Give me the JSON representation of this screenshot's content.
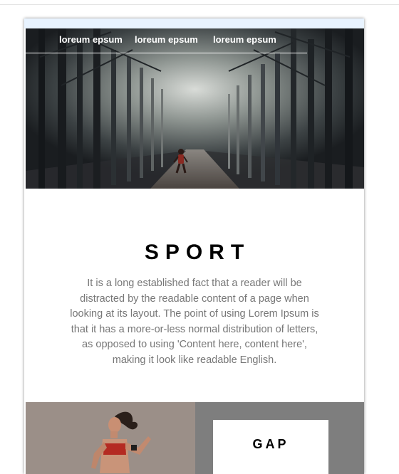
{
  "nav": {
    "items": [
      {
        "label": "loreum epsum"
      },
      {
        "label": "loreum epsum"
      },
      {
        "label": "loreum epsum"
      }
    ]
  },
  "hero": {
    "icon": "forest-runner-photo"
  },
  "section": {
    "title": "SPORT",
    "body": "It is a long established fact that a reader will be distracted by the readable content of a page when looking at its layout. The point of using Lorem Ipsum is that it has a more-or-less normal distribution of letters, as opposed to using 'Content here, content here', making it look like readable English."
  },
  "feature": {
    "image_icon": "woman-runner-photo",
    "box_label": "GAP"
  },
  "colors": {
    "card_top": "#e8f3ff",
    "text_muted": "#777777",
    "gray_panel": "#7e7e7e"
  }
}
